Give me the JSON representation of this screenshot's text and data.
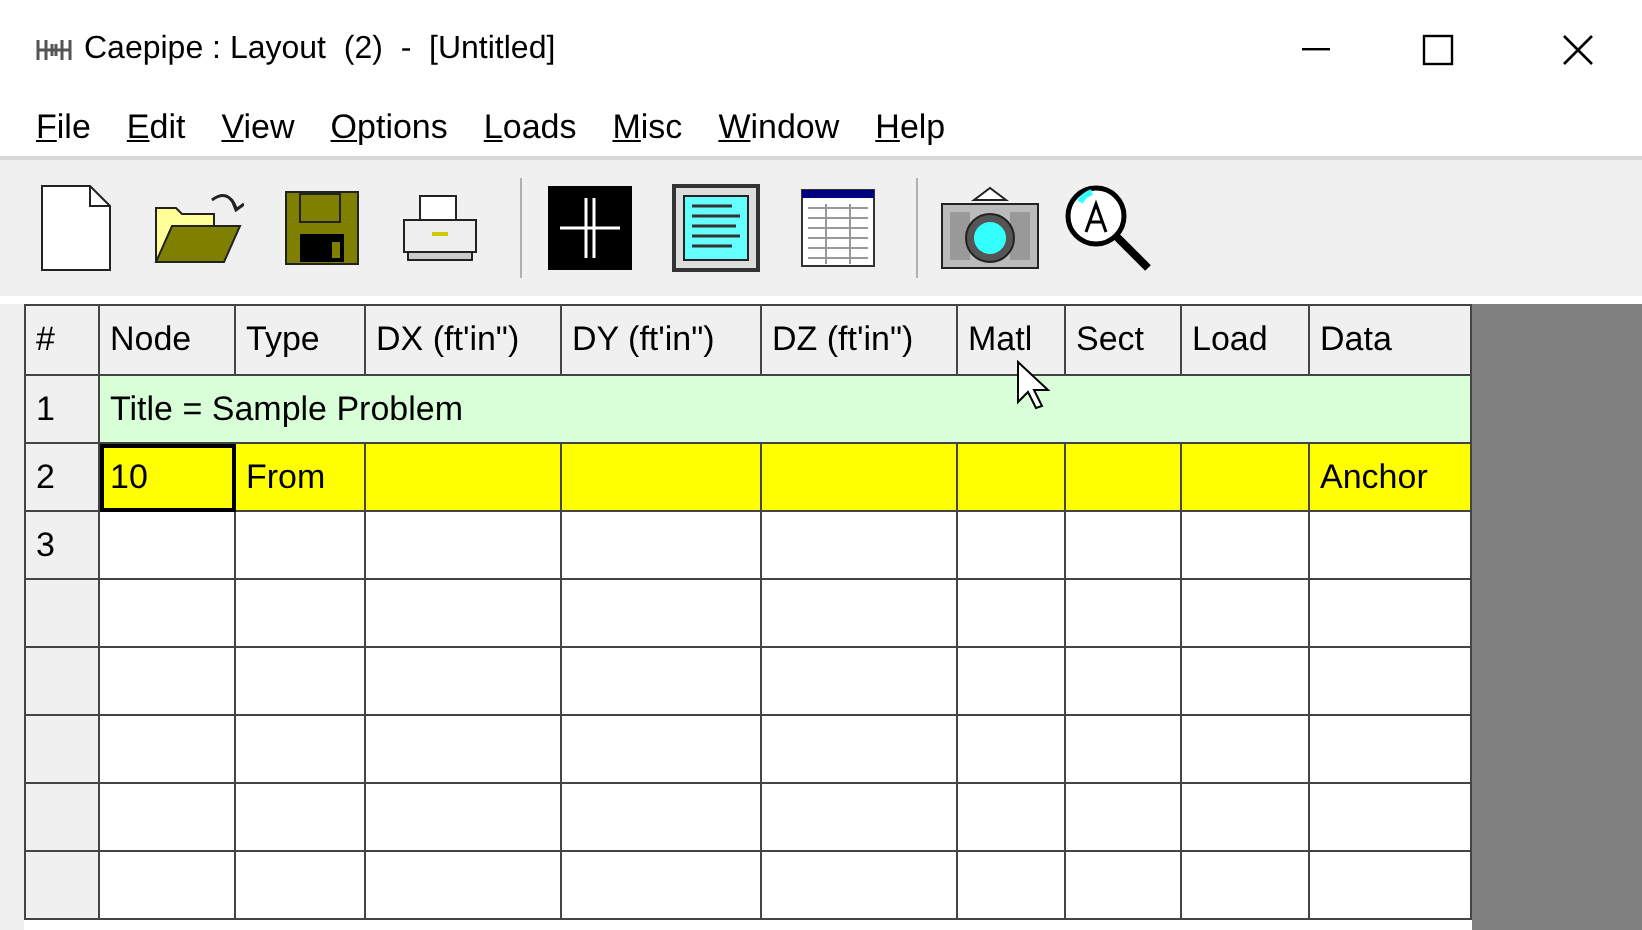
{
  "window": {
    "title": "Caepipe : Layout  (2)  -  [Untitled]"
  },
  "menu": [
    {
      "label": "File"
    },
    {
      "label": "Edit"
    },
    {
      "label": "View"
    },
    {
      "label": "Options"
    },
    {
      "label": "Loads"
    },
    {
      "label": "Misc"
    },
    {
      "label": "Window"
    },
    {
      "label": "Help"
    }
  ],
  "table": {
    "columns": [
      "#",
      "Node",
      "Type",
      "DX (ft'in\")",
      "DY (ft'in\")",
      "DZ (ft'in\")",
      "Matl",
      "Sect",
      "Load",
      "Data"
    ],
    "rows": [
      {
        "number": "1",
        "kind": "title",
        "color": "#d9ffd9",
        "text": "Title = Sample Problem"
      },
      {
        "number": "2",
        "kind": "data",
        "color": "#ffff00",
        "node": "10",
        "node_selected": true,
        "type": "From",
        "data": "Anchor"
      },
      {
        "number": "3",
        "kind": "empty"
      }
    ]
  }
}
